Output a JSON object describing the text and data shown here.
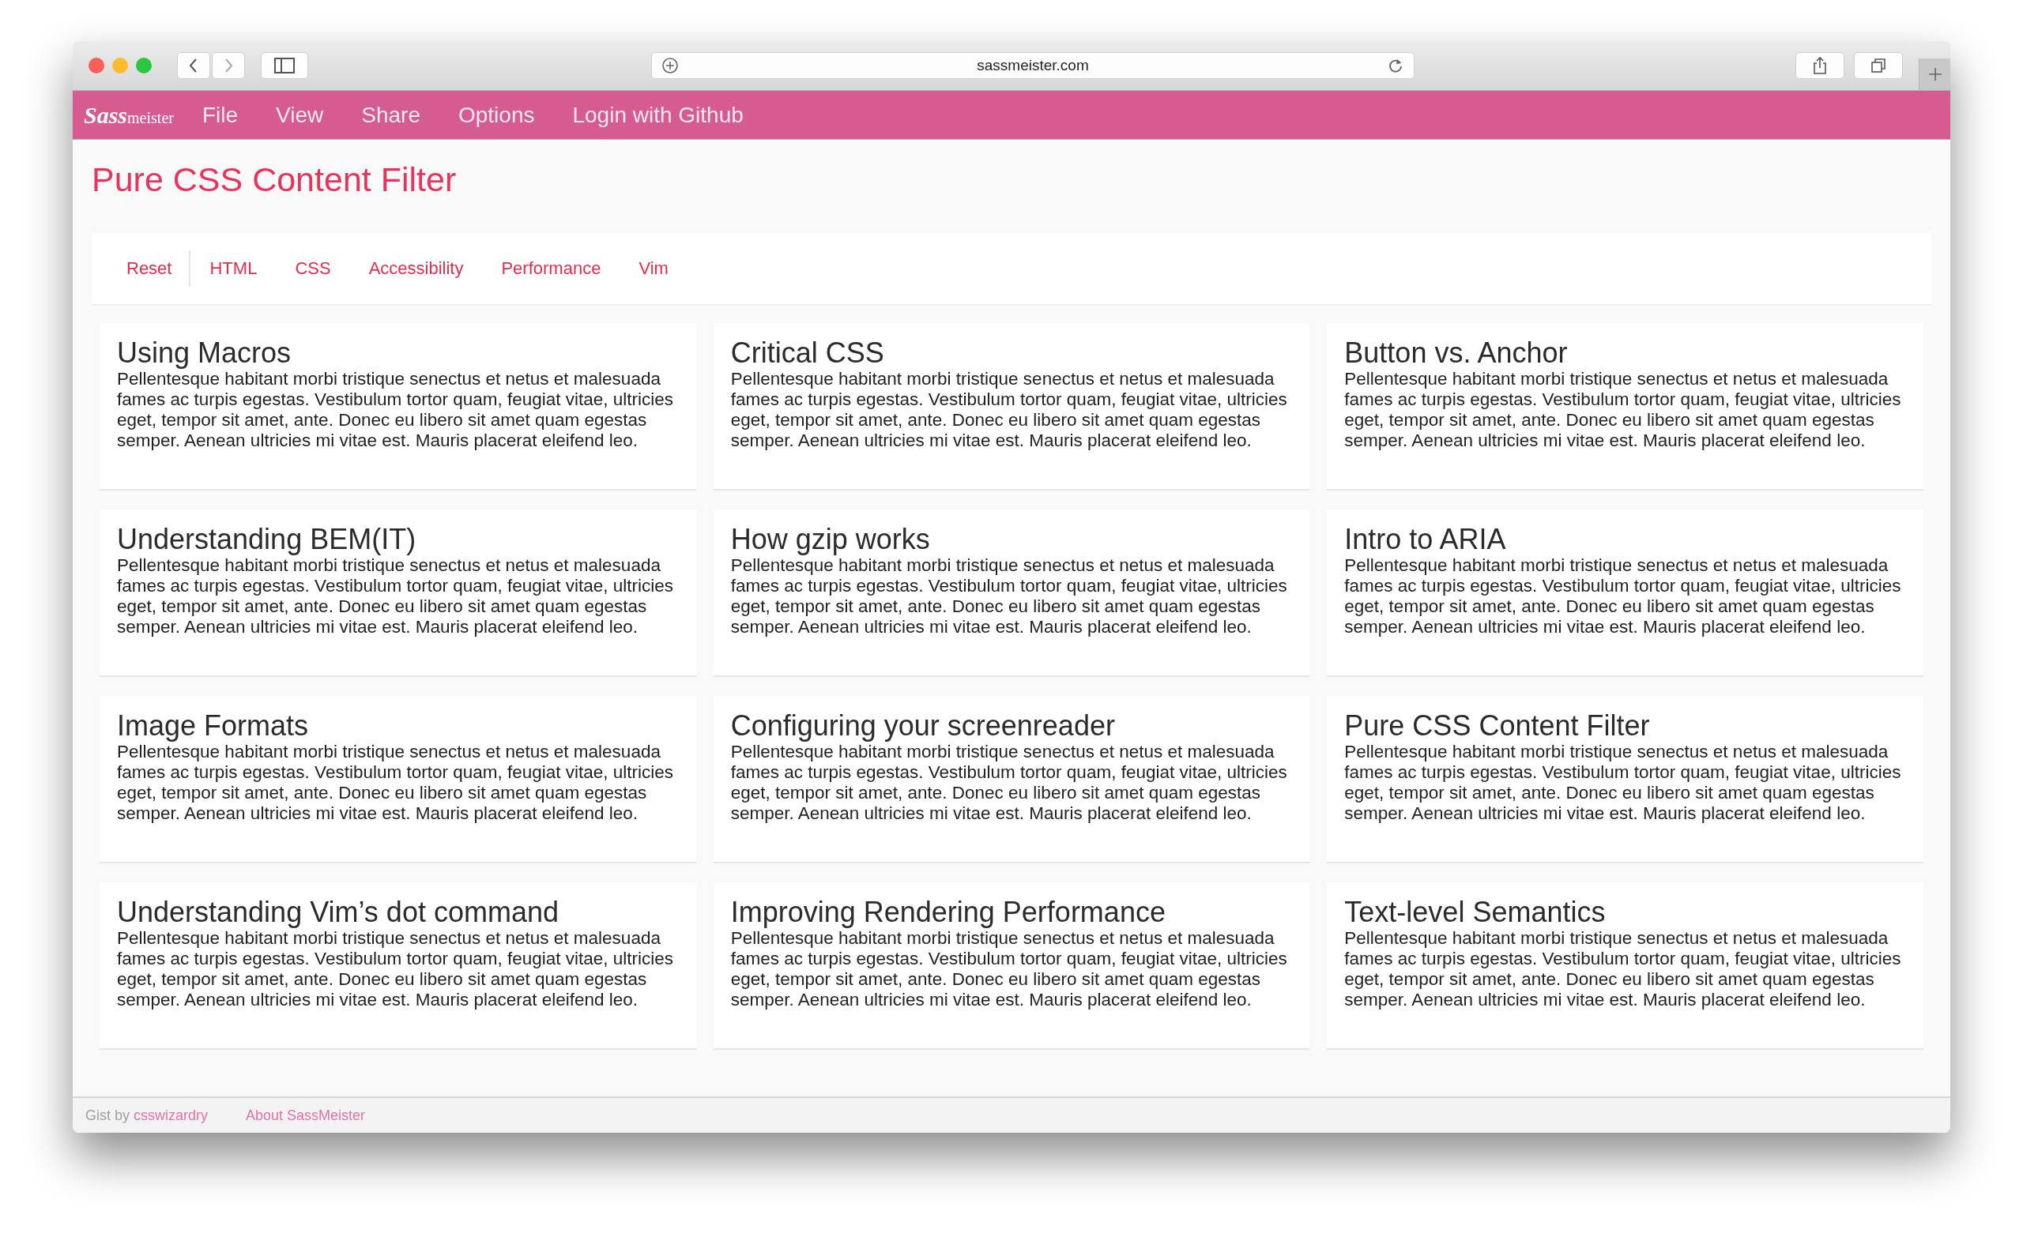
{
  "browser": {
    "url": "sassmeister.com"
  },
  "app_bar": {
    "logo": {
      "script": "Sass",
      "word": "meister"
    },
    "menu": [
      "File",
      "View",
      "Share",
      "Options",
      "Login with Github"
    ]
  },
  "page_title": "Pure CSS Content Filter",
  "filters": [
    {
      "label": "Reset",
      "kind": "reset"
    },
    {
      "label": "HTML",
      "kind": "filter"
    },
    {
      "label": "CSS",
      "kind": "filter"
    },
    {
      "label": "Accessibility",
      "kind": "filter"
    },
    {
      "label": "Performance",
      "kind": "filter"
    },
    {
      "label": "Vim",
      "kind": "filter"
    }
  ],
  "articles": [
    {
      "title": "Using Macros",
      "body": "Pellentesque habitant morbi tristique senectus et netus et malesuada fames ac turpis egestas. Vestibulum tortor quam, feugiat vitae, ultricies eget, tempor sit amet, ante. Donec eu libero sit amet quam egestas semper. Aenean ultricies mi vitae est. Mauris placerat eleifend leo."
    },
    {
      "title": "Critical CSS",
      "body": "Pellentesque habitant morbi tristique senectus et netus et malesuada fames ac turpis egestas. Vestibulum tortor quam, feugiat vitae, ultricies eget, tempor sit amet, ante. Donec eu libero sit amet quam egestas semper. Aenean ultricies mi vitae est. Mauris placerat eleifend leo."
    },
    {
      "title": "Button vs. Anchor",
      "body": "Pellentesque habitant morbi tristique senectus et netus et malesuada fames ac turpis egestas. Vestibulum tortor quam, feugiat vitae, ultricies eget, tempor sit amet, ante. Donec eu libero sit amet quam egestas semper. Aenean ultricies mi vitae est. Mauris placerat eleifend leo."
    },
    {
      "title": "Understanding BEM(IT)",
      "body": "Pellentesque habitant morbi tristique senectus et netus et malesuada fames ac turpis egestas. Vestibulum tortor quam, feugiat vitae, ultricies eget, tempor sit amet, ante. Donec eu libero sit amet quam egestas semper. Aenean ultricies mi vitae est. Mauris placerat eleifend leo."
    },
    {
      "title": "How gzip works",
      "body": "Pellentesque habitant morbi tristique senectus et netus et malesuada fames ac turpis egestas. Vestibulum tortor quam, feugiat vitae, ultricies eget, tempor sit amet, ante. Donec eu libero sit amet quam egestas semper. Aenean ultricies mi vitae est. Mauris placerat eleifend leo."
    },
    {
      "title": "Intro to ARIA",
      "body": "Pellentesque habitant morbi tristique senectus et netus et malesuada fames ac turpis egestas. Vestibulum tortor quam, feugiat vitae, ultricies eget, tempor sit amet, ante. Donec eu libero sit amet quam egestas semper. Aenean ultricies mi vitae est. Mauris placerat eleifend leo."
    },
    {
      "title": "Image Formats",
      "body": "Pellentesque habitant morbi tristique senectus et netus et malesuada fames ac turpis egestas. Vestibulum tortor quam, feugiat vitae, ultricies eget, tempor sit amet, ante. Donec eu libero sit amet quam egestas semper. Aenean ultricies mi vitae est. Mauris placerat eleifend leo."
    },
    {
      "title": "Configuring your screenreader",
      "body": "Pellentesque habitant morbi tristique senectus et netus et malesuada fames ac turpis egestas. Vestibulum tortor quam, feugiat vitae, ultricies eget, tempor sit amet, ante. Donec eu libero sit amet quam egestas semper. Aenean ultricies mi vitae est. Mauris placerat eleifend leo."
    },
    {
      "title": "Pure CSS Content Filter",
      "body": "Pellentesque habitant morbi tristique senectus et netus et malesuada fames ac turpis egestas. Vestibulum tortor quam, feugiat vitae, ultricies eget, tempor sit amet, ante. Donec eu libero sit amet quam egestas semper. Aenean ultricies mi vitae est. Mauris placerat eleifend leo."
    },
    {
      "title": "Understanding Vim’s dot command",
      "body": "Pellentesque habitant morbi tristique senectus et netus et malesuada fames ac turpis egestas. Vestibulum tortor quam, feugiat vitae, ultricies eget, tempor sit amet, ante. Donec eu libero sit amet quam egestas semper. Aenean ultricies mi vitae est. Mauris placerat eleifend leo."
    },
    {
      "title": "Improving Rendering Performance",
      "body": "Pellentesque habitant morbi tristique senectus et netus et malesuada fames ac turpis egestas. Vestibulum tortor quam, feugiat vitae, ultricies eget, tempor sit amet, ante. Donec eu libero sit amet quam egestas semper. Aenean ultricies mi vitae est. Mauris placerat eleifend leo."
    },
    {
      "title": "Text-level Semantics",
      "body": "Pellentesque habitant morbi tristique senectus et netus et malesuada fames ac turpis egestas. Vestibulum tortor quam, feugiat vitae, ultricies eget, tempor sit amet, ante. Donec eu libero sit amet quam egestas semper. Aenean ultricies mi vitae est. Mauris placerat eleifend leo."
    }
  ],
  "footer": {
    "gist_prefix": "Gist by",
    "gist_author": "csswizardry",
    "about_link": "About SassMeister"
  }
}
